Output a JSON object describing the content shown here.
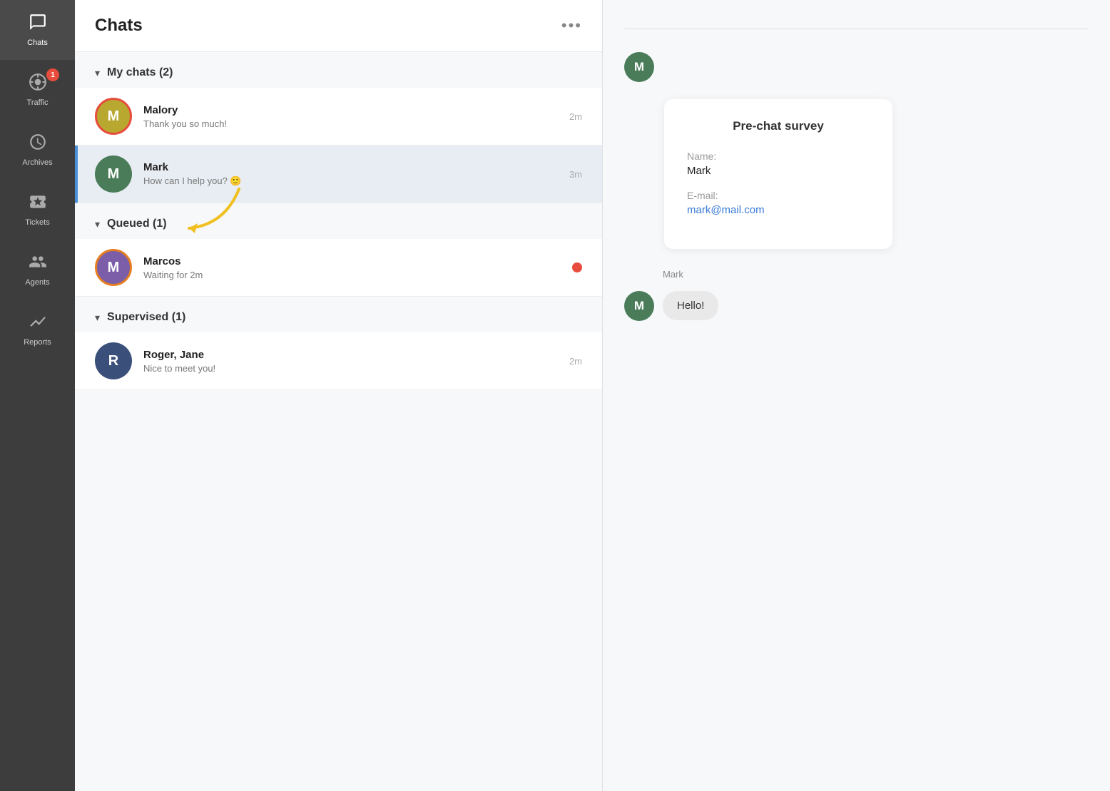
{
  "sidebar": {
    "items": [
      {
        "id": "chats",
        "label": "Chats",
        "icon": "💬",
        "active": true,
        "badge": null
      },
      {
        "id": "traffic",
        "label": "Traffic",
        "icon": "🎯",
        "active": false,
        "badge": 1
      },
      {
        "id": "archives",
        "label": "Archives",
        "icon": "🕐",
        "active": false,
        "badge": null
      },
      {
        "id": "tickets",
        "label": "Tickets",
        "icon": "🎫",
        "active": false,
        "badge": null
      },
      {
        "id": "agents",
        "label": "Agents",
        "icon": "👥",
        "active": false,
        "badge": null
      },
      {
        "id": "reports",
        "label": "Reports",
        "icon": "📈",
        "active": false,
        "badge": null
      }
    ]
  },
  "header": {
    "title": "Chats",
    "more_label": "•••"
  },
  "sections": {
    "my_chats": {
      "label": "My chats (2)",
      "items": [
        {
          "name": "Malory",
          "preview": "Thank you so much!",
          "time": "2m",
          "avatar_letter": "M",
          "avatar_color": "olive",
          "ring": "red",
          "selected": false
        },
        {
          "name": "Mark",
          "preview": "How can I help you? 🙂",
          "time": "3m",
          "avatar_letter": "M",
          "avatar_color": "green",
          "ring": null,
          "selected": true
        }
      ]
    },
    "queued": {
      "label": "Queued (1)",
      "items": [
        {
          "name": "Marcos",
          "preview": "Waiting for 2m",
          "time": null,
          "avatar_letter": "M",
          "avatar_color": "purple",
          "ring": "red",
          "red_dot": true,
          "selected": false
        }
      ]
    },
    "supervised": {
      "label": "Supervised (1)",
      "items": [
        {
          "name": "Roger, Jane",
          "preview": "Nice to meet you!",
          "time": "2m",
          "avatar_letter": "R",
          "avatar_color": "navy",
          "ring": null,
          "selected": false
        }
      ]
    }
  },
  "main": {
    "chat_user": "Mark",
    "avatar_letter": "M",
    "survey": {
      "title": "Pre-chat survey",
      "fields": [
        {
          "label": "Name:",
          "value": "Mark",
          "is_link": false
        },
        {
          "label": "E-mail:",
          "value": "mark@mail.com",
          "is_link": true
        }
      ]
    },
    "message_sender": "Mark",
    "message_text": "Hello!"
  },
  "arrow": {
    "annotation": "queued-arrow"
  }
}
